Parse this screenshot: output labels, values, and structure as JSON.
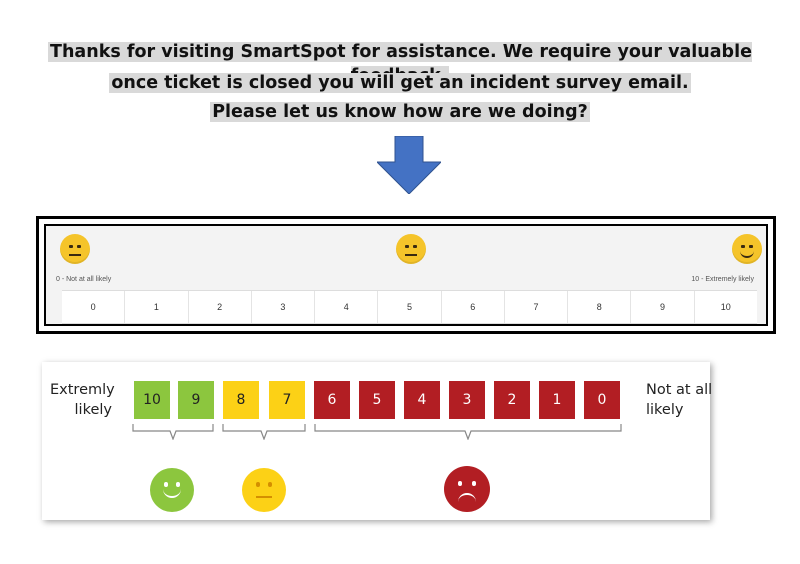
{
  "header": {
    "line1": "Thanks for visiting SmartSpot for assistance. We require your valuable feedback,",
    "line2": "once ticket is closed you will get an incident survey email.",
    "line3": "Please let us know how are we doing?"
  },
  "arrow": {
    "icon": "down-arrow-icon",
    "color": "#4472c4"
  },
  "survey_widget": {
    "low_label": "0 - Not at all likely",
    "high_label": "10 - Extremely likely",
    "scale": [
      "0",
      "1",
      "2",
      "3",
      "4",
      "5",
      "6",
      "7",
      "8",
      "9",
      "10"
    ],
    "face_icons": [
      "neutral-face-icon",
      "neutral-face-icon",
      "smiling-face-icon"
    ]
  },
  "nps_legend": {
    "left_label_line1": "Extremly",
    "left_label_line2": "likely",
    "right_label_line1": "Not at all",
    "right_label_line2": "likely",
    "promoters": [
      "10",
      "9"
    ],
    "passives": [
      "8",
      "7"
    ],
    "detractors": [
      "6",
      "5",
      "4",
      "3",
      "2",
      "1",
      "0"
    ],
    "colors": {
      "promoter": "#8cc63e",
      "passive": "#fcd116",
      "detractor": "#b21e23"
    },
    "face_icons": [
      "happy-face-icon",
      "neutral-face-icon",
      "sad-face-icon"
    ]
  }
}
